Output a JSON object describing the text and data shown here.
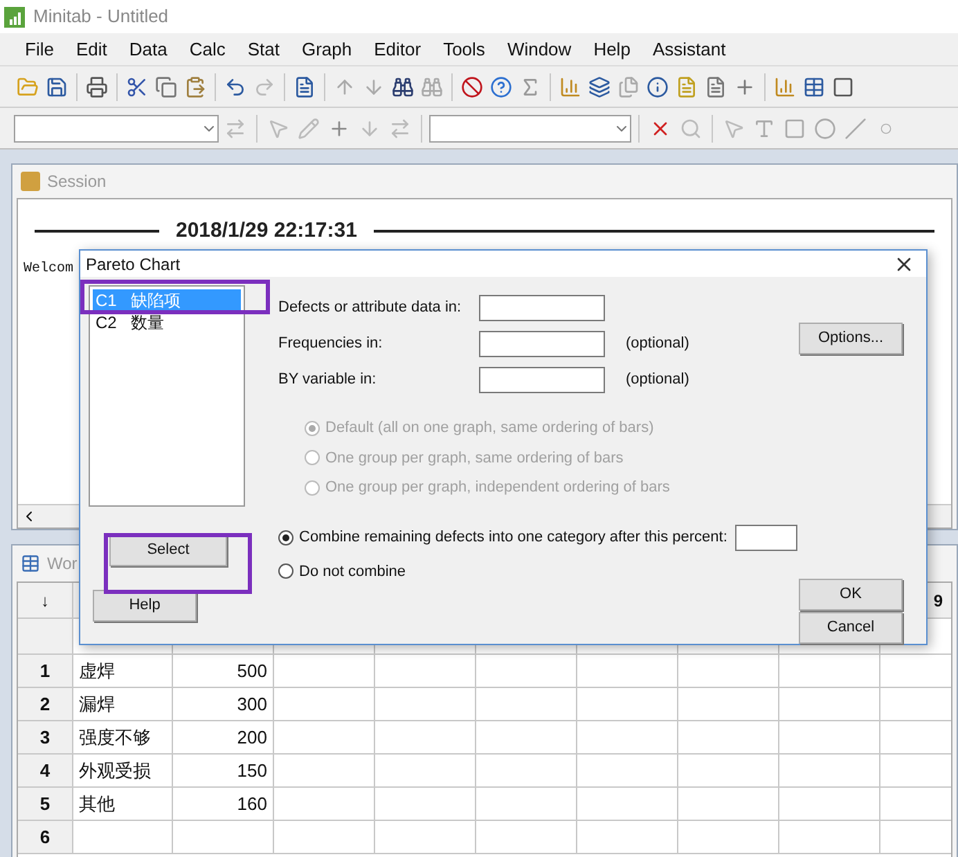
{
  "window": {
    "title": "Minitab - Untitled"
  },
  "menu": [
    {
      "label": "File"
    },
    {
      "label": "Edit"
    },
    {
      "label": "Data"
    },
    {
      "label": "Calc"
    },
    {
      "label": "Stat"
    },
    {
      "label": "Graph"
    },
    {
      "label": "Editor"
    },
    {
      "label": "Tools"
    },
    {
      "label": "Window"
    },
    {
      "label": "Help"
    },
    {
      "label": "Assistant"
    }
  ],
  "session": {
    "title": "Session",
    "timestamp": "2018/1/29 22:17:31",
    "text": "Welcom"
  },
  "worksheet": {
    "title": "Wor",
    "header_arrow": "↓",
    "last_column_header": "9",
    "rows": [
      {
        "number": "1",
        "c1": "虚焊",
        "c2": "500"
      },
      {
        "number": "2",
        "c1": "漏焊",
        "c2": "300"
      },
      {
        "number": "3",
        "c1": "强度不够",
        "c2": "200"
      },
      {
        "number": "4",
        "c1": "外观受损",
        "c2": "150"
      },
      {
        "number": "5",
        "c1": "其他",
        "c2": "160"
      },
      {
        "number": "6"
      }
    ]
  },
  "dialog": {
    "title": "Pareto Chart",
    "columns": [
      {
        "id": "C1",
        "name": "缺陷项",
        "selected": true
      },
      {
        "id": "C2",
        "name": "数量",
        "selected": false
      }
    ],
    "fields": [
      {
        "label": "Defects or attribute data in:"
      },
      {
        "label": "Frequencies in:",
        "note": "(optional)"
      },
      {
        "label": "BY variable in:",
        "note": "(optional)"
      }
    ],
    "by_options": [
      {
        "label": "Default (all on one graph, same ordering of bars)",
        "selected": true,
        "disabled": true
      },
      {
        "label": "One group per graph, same ordering of bars",
        "selected": false,
        "disabled": true
      },
      {
        "label": "One group per graph, independent ordering of bars",
        "selected": false,
        "disabled": true
      }
    ],
    "combine_options": [
      {
        "label": "Combine remaining defects into one category after this percent:",
        "selected": true,
        "kind": "with_field"
      },
      {
        "label": "Do not combine",
        "selected": false,
        "kind": "plain"
      }
    ],
    "select_button": "Select",
    "help_button": "Help",
    "options_button": "Options...",
    "ok_button": "OK",
    "cancel_button": "Cancel"
  }
}
